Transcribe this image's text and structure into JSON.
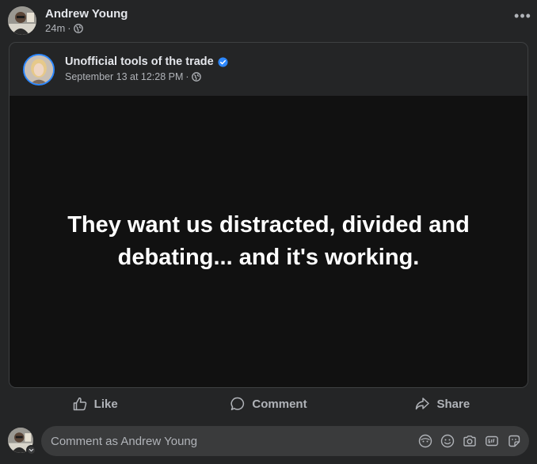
{
  "post": {
    "author_name": "Andrew Young",
    "time": "24m",
    "separator": "·",
    "audience_icon": "globe-icon",
    "more_icon": "more-options-icon",
    "more_label": "•••"
  },
  "shared": {
    "page_name": "Unofficial tools of the trade",
    "verified": true,
    "date": "September 13 at 12:28 PM",
    "separator": "·",
    "audience_icon": "globe-icon",
    "quote": "They want us distracted, divided and debating... and it's working."
  },
  "actions": {
    "like": {
      "label": "Like",
      "icon": "thumbs-up-icon"
    },
    "comment": {
      "label": "Comment",
      "icon": "comment-bubble-icon"
    },
    "share": {
      "label": "Share",
      "icon": "share-arrow-icon"
    }
  },
  "composer": {
    "placeholder": "Comment as Andrew Young",
    "tools": [
      "avatar-sticker-icon",
      "emoji-icon",
      "camera-icon",
      "gif-icon",
      "sticker-icon"
    ]
  },
  "colors": {
    "background": "#242526",
    "text_primary": "#e4e6eb",
    "text_secondary": "#b0b3b8",
    "media_background": "#111111",
    "verified_blue": "#2d88ff"
  }
}
